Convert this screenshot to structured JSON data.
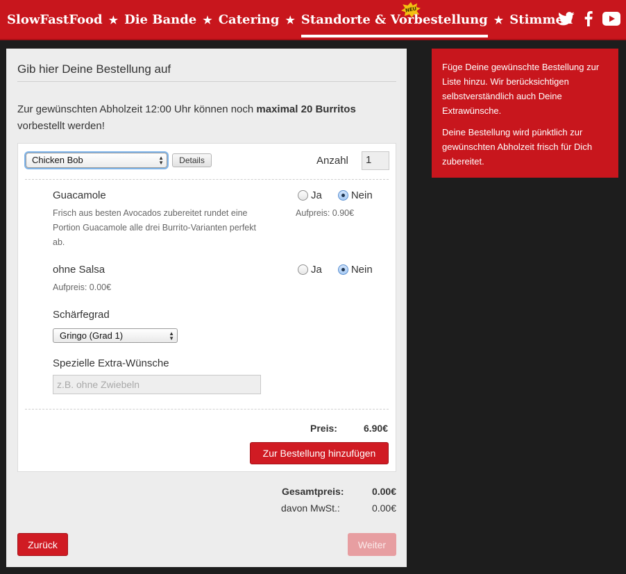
{
  "nav": {
    "items": [
      "SlowFastFood",
      "Die Bande",
      "Catering",
      "Standorte & Vorbestellung",
      "Stimmen"
    ],
    "star": "★",
    "badge": "NEU",
    "social": [
      "twitter-icon",
      "facebook-icon",
      "youtube-icon"
    ]
  },
  "colors": {
    "brand_red": "#c8161d",
    "background": "#1d1d1d",
    "panel": "#ededed"
  },
  "order": {
    "heading": "Gib hier Deine Bestellung auf",
    "intro_prefix": "Zur gewünschten Abholzeit 12:00 Uhr können noch ",
    "intro_bold": "maximal 20 Burritos",
    "intro_suffix": " vorbestellt werden!",
    "product": "Chicken Bob",
    "details_label": "Details",
    "quantity_label": "Anzahl",
    "quantity": "1",
    "options": [
      {
        "title": "Guacamole",
        "description": "Frisch aus besten Avocados zubereitet rundet eine Portion Guacamole alle drei Burrito-Varianten perfekt ab.",
        "yes": "Ja",
        "no": "Nein",
        "selected": "Nein",
        "surcharge": "Aufpreis: 0.90€"
      },
      {
        "title": "ohne Salsa",
        "yes": "Ja",
        "no": "Nein",
        "selected": "Nein",
        "surcharge": "Aufpreis: 0.00€"
      }
    ],
    "spice_label": "Schärfegrad",
    "spice_value": "Gringo (Grad 1)",
    "wishes_label": "Spezielle Extra-Wünsche",
    "wishes_placeholder": "z.B. ohne Zwiebeln",
    "price_label": "Preis:",
    "price_value": "6.90€",
    "add_button": "Zur Bestellung hinzufügen"
  },
  "totals": {
    "total_label": "Gesamtpreis:",
    "total_value": "0.00€",
    "vat_label": "davon MwSt.:",
    "vat_value": "0.00€"
  },
  "buttons": {
    "back": "Zurück",
    "next": "Weiter"
  },
  "info": {
    "p1": "Füge Deine gewünschte Bestellung zur Liste hinzu. Wir berücksichtigen selbstverständlich auch Deine Extrawünsche.",
    "p2": "Deine Bestellung wird pünktlich zur gewünschten Abholzeit frisch für Dich zubereitet."
  }
}
